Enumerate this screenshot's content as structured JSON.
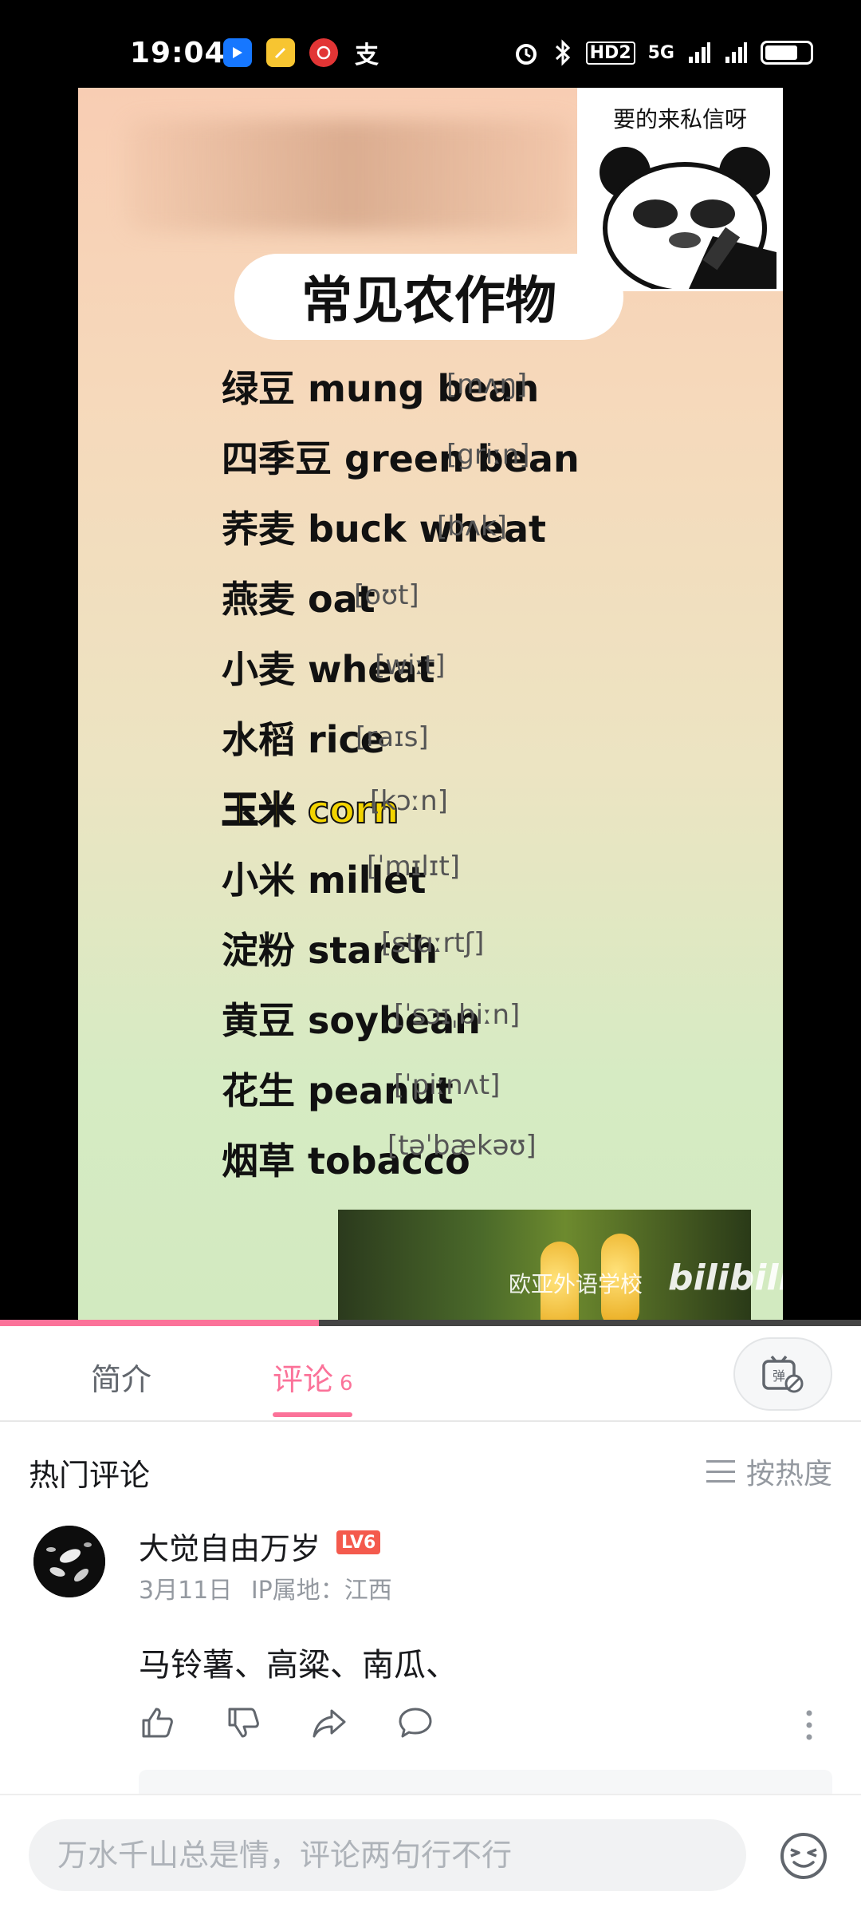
{
  "status_bar": {
    "time": "19:04",
    "app_icons": [
      "blue-app-icon",
      "notes-app-icon",
      "bank-app-icon",
      "alipay-icon"
    ],
    "alipay_glyph": "支",
    "network": "5G",
    "hd_label": "HD2",
    "battery_level": 0.7
  },
  "video": {
    "meme_caption": "要的来私信呀",
    "title": "常见农作物",
    "words": [
      {
        "text": "绿豆 mung bean",
        "phonetic": "[mʌŋ]"
      },
      {
        "text": "四季豆 green bean",
        "phonetic": "[griːn]"
      },
      {
        "text": "荞麦 buck wheat",
        "phonetic": "[bʌk]"
      },
      {
        "text": "燕麦 oat",
        "phonetic": "[oʊt]"
      },
      {
        "text": "小麦 wheat",
        "phonetic": "[wiːt]"
      },
      {
        "text": "水稻 rice",
        "phonetic": "[raɪs]"
      },
      {
        "text": "玉米 corn",
        "phonetic": "[kɔːn]",
        "highlight": true
      },
      {
        "text": "小米 millet",
        "phonetic": "[ˈmɪlɪt]"
      },
      {
        "text": "淀粉 starch",
        "phonetic": "[stɑːrtʃ]"
      },
      {
        "text": "黄豆 soybean",
        "phonetic": "[ˈsɔɪˌbiːn]"
      },
      {
        "text": "花生 peanut",
        "phonetic": "[ˈpiːnʌt]"
      },
      {
        "text": "烟草 tobacco",
        "phonetic": "[təˈbækəʊ]"
      }
    ],
    "watermark": "欧亚外语学校",
    "platform_logo": "bilibili",
    "progress": 0.37
  },
  "tabs": {
    "intro_label": "简介",
    "comments_label": "评论",
    "comments_count": "6",
    "danmaku_icon": "danmaku-toggle-icon"
  },
  "comments": {
    "section_title": "热门评论",
    "sort_label": "按热度",
    "items": [
      {
        "username": "大觉自由万岁",
        "level": "LV6",
        "date": "3月11日",
        "ip_location": "IP属地：江西",
        "text": "马铃薯、高粱、南瓜、"
      }
    ]
  },
  "input": {
    "placeholder": "万水千山总是情，评论两句行不行"
  },
  "colors": {
    "accent": "#fb7299",
    "level_badge": "#f45a4d",
    "muted_text": "#9499a0"
  }
}
